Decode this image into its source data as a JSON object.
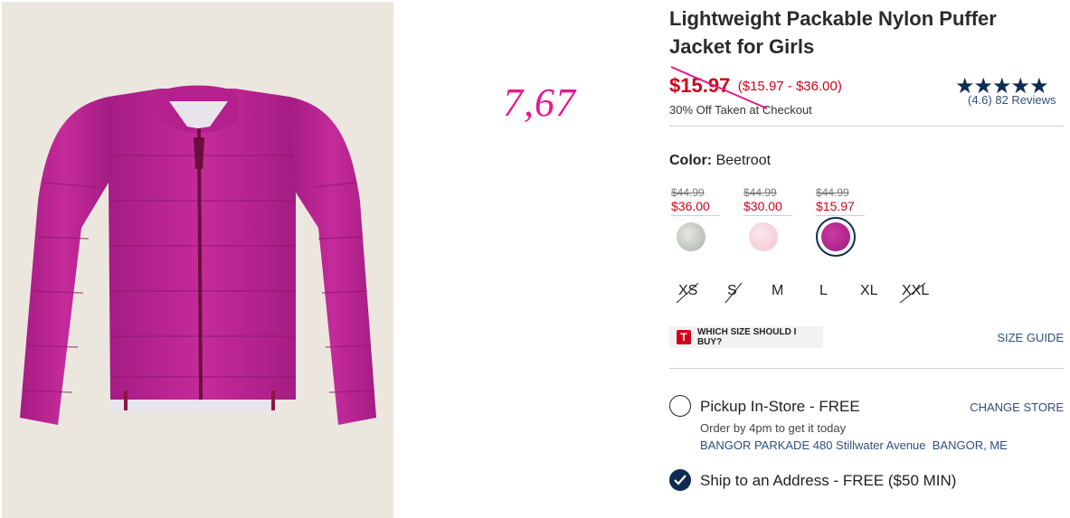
{
  "product": {
    "title": "Lightweight Packable Nylon Puffer Jacket for Girls",
    "sale_price": "$15.97",
    "price_range": "($15.97 - $36.00)",
    "promo": "30% Off Taken at Checkout",
    "rating_value": 4.6,
    "reviews_text": "(4.6) 82 Reviews",
    "stars": "★★★★★"
  },
  "annotation": {
    "handwritten_price": "7,67",
    "color": "#e6198c"
  },
  "color": {
    "label": "Color:",
    "value": "Beetroot"
  },
  "swatches": [
    {
      "was": "$44.99",
      "now": "$36.00",
      "color": "#c9cdc6"
    },
    {
      "was": "$44.99",
      "now": "$30.00",
      "color": "#f6d3dc"
    },
    {
      "was": "$44.99",
      "now": "$15.97",
      "color": "#b4208d"
    }
  ],
  "sizes": [
    {
      "label": "XS",
      "available": false
    },
    {
      "label": "S",
      "available": false
    },
    {
      "label": "M",
      "available": true
    },
    {
      "label": "L",
      "available": true
    },
    {
      "label": "XL",
      "available": true
    },
    {
      "label": "XXL",
      "available": false
    }
  ],
  "size_help": {
    "badge": "T",
    "label": "WHICH SIZE SHOULD I BUY?"
  },
  "size_guide": "SIZE GUIDE",
  "fulfillment": {
    "pickup_label": "Pickup In-Store - FREE",
    "change_store": "CHANGE STORE",
    "order_note": "Order by 4pm to get it today",
    "store_address": "BANGOR PARKADE 480 Stillwater Avenue  BANGOR, ME",
    "ship_label": "Ship to an Address - FREE ($50 MIN)"
  },
  "colors": {
    "accent_red": "#d0021b",
    "navy": "#0e2c52",
    "link_blue": "#314e7d",
    "jacket": "#b4208d"
  }
}
